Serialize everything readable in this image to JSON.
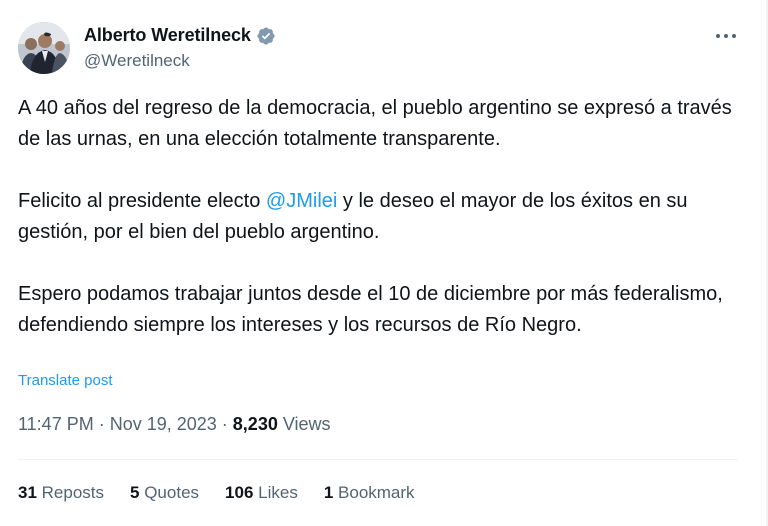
{
  "author": {
    "display_name": "Alberto Weretilneck",
    "handle": "@Weretilneck",
    "verified": true
  },
  "tweet": {
    "paragraph1": "A 40 años del regreso de la democracia, el pueblo argentino se expresó a través de las urnas, en una elección totalmente transparente.",
    "paragraph2_before": "Felicito al presidente electo ",
    "paragraph2_mention": "@JMilei",
    "paragraph2_after": " y le deseo el mayor de los éxitos en su gestión, por el bien del pueblo argentino.",
    "paragraph3": "Espero podamos trabajar juntos desde el 10 de diciembre por más federalismo, defendiendo siempre los intereses y los recursos de Río Negro."
  },
  "translate_label": "Translate post",
  "meta": {
    "time": "11:47 PM",
    "separator": " · ",
    "date": "Nov 19, 2023",
    "views_count": "8,230",
    "views_label": " Views"
  },
  "stats": {
    "reposts_count": "31",
    "reposts_label": " Reposts",
    "quotes_count": "5",
    "quotes_label": " Quotes",
    "likes_count": "106",
    "likes_label": " Likes",
    "bookmarks_count": "1",
    "bookmarks_label": " Bookmark"
  },
  "colors": {
    "link": "#1d9bf0",
    "secondary_text": "#536471",
    "primary_text": "#0f1419",
    "divider": "#eff3f4"
  },
  "icons": [
    "avatar-photo",
    "verified-badge-icon",
    "more-options-icon"
  ]
}
